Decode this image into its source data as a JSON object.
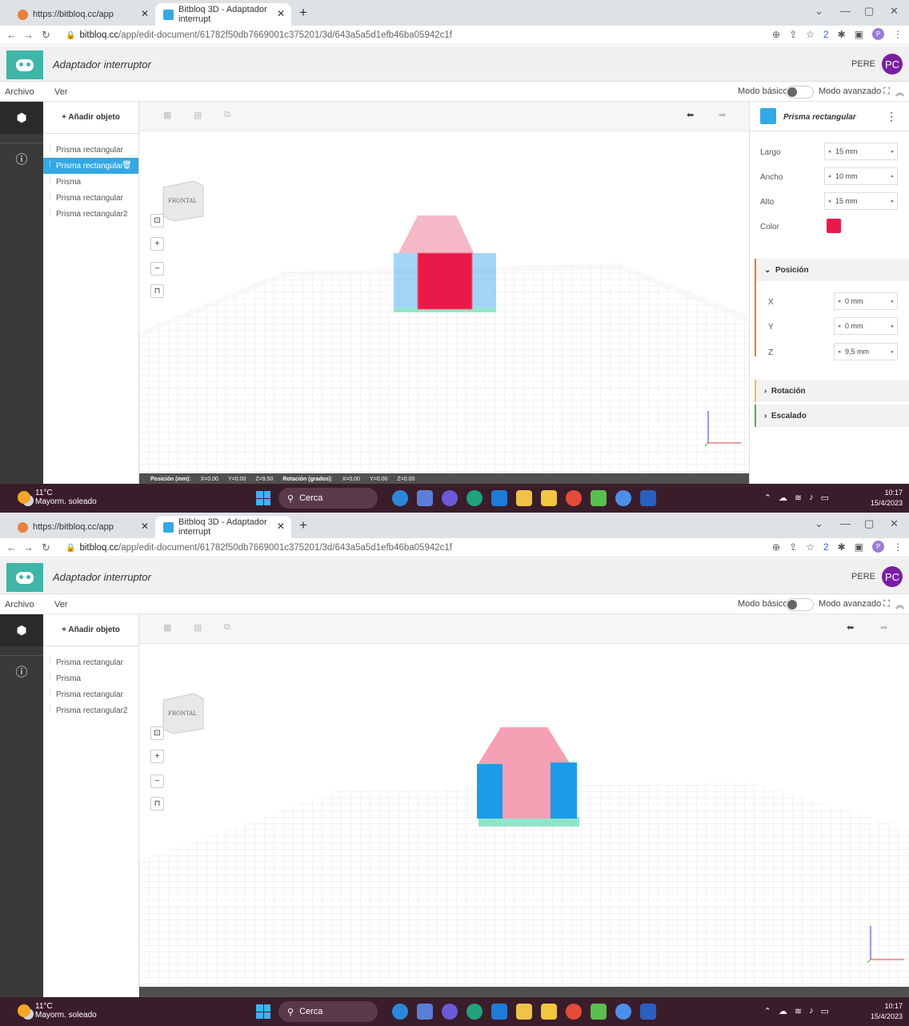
{
  "browser": {
    "tabs": [
      {
        "label": "https://bitbloq.cc/app"
      },
      {
        "label": "Bitbloq 3D - Adaptador interrupt"
      }
    ],
    "url_host": "bitbloq.cc",
    "url_path": "/app/edit-document/61782f50db7669001c375201/3d/643a5a5d1efb46ba05942c1f",
    "profile_initial": "P",
    "extensions_badge": "2"
  },
  "app": {
    "document_title": "Adaptador interruptor",
    "user_name": "PERE",
    "user_initials": "PC",
    "menu": [
      "Archivo",
      "Ver"
    ],
    "mode_basic": "Modo básico",
    "mode_advanced": "Modo avanzado",
    "add_object": "+ Añadir objeto",
    "frontal_label": "FRONTAL"
  },
  "screens": [
    {
      "objects": [
        {
          "label": "Prisma rectangular",
          "selected": false
        },
        {
          "label": "Prisma rectangular",
          "selected": true
        },
        {
          "label": "Prisma",
          "selected": false
        },
        {
          "label": "Prisma rectangular",
          "selected": false
        },
        {
          "label": "Prisma rectangular2",
          "selected": false
        }
      ],
      "status": {
        "position_label": "Posición (mm):",
        "pos_x": "X=0.00",
        "pos_y": "Y=0.00",
        "pos_z": "Z=9.50",
        "rotation_label": "Rotación (grados):",
        "rot_x": "X=0.00",
        "rot_y": "Y=0.00",
        "rot_z": "Z=0.00"
      },
      "properties": {
        "title": "Prisma rectangular",
        "largo_label": "Largo",
        "largo": "15 mm",
        "ancho_label": "Ancho",
        "ancho": "10 mm",
        "alto_label": "Alto",
        "alto": "15 mm",
        "color_label": "Color",
        "color": "#e91a4a",
        "position_section": "Posición",
        "x_label": "X",
        "x": "0 mm",
        "y_label": "Y",
        "y": "0 mm",
        "z_label": "Z",
        "z": "9,5 mm",
        "rotation_section": "Rotación",
        "scale_section": "Escalado"
      }
    },
    {
      "objects": [
        {
          "label": "Prisma rectangular",
          "selected": false
        },
        {
          "label": "Prisma",
          "selected": false
        },
        {
          "label": "Prisma rectangular",
          "selected": false
        },
        {
          "label": "Prisma rectangular2",
          "selected": false
        }
      ]
    }
  ],
  "taskbar": {
    "temperature": "11°C",
    "weather": "Mayorm. soleado",
    "search": "Cerca",
    "time": "10:17",
    "date": "15/4/2023"
  },
  "colors": {
    "accent": "#34a7e4",
    "selected_shape": "#e91a4a",
    "roof": "#f5b8c6",
    "wall": "#1e9be6",
    "base": "#7de0c0",
    "position_border": "#e07b2a",
    "rotation_border": "#f0c040",
    "scale_border": "#4caf50"
  },
  "icons": [
    "cube-icon",
    "info-icon",
    "undo-icon",
    "redo-icon",
    "zoom-fit-icon",
    "zoom-in-icon",
    "zoom-out-icon",
    "perspective-icon",
    "trash-icon",
    "kebab-menu-icon",
    "lock-icon",
    "windows-logo-icon",
    "search-icon"
  ]
}
